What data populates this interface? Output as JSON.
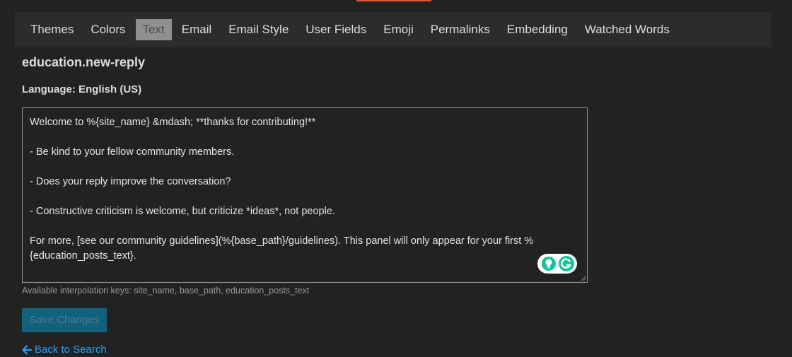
{
  "nav": {
    "items": [
      {
        "label": "Themes"
      },
      {
        "label": "Colors"
      },
      {
        "label": "Text",
        "active": true
      },
      {
        "label": "Email"
      },
      {
        "label": "Email Style"
      },
      {
        "label": "User Fields"
      },
      {
        "label": "Emoji"
      },
      {
        "label": "Permalinks"
      },
      {
        "label": "Embedding"
      },
      {
        "label": "Watched Words"
      }
    ]
  },
  "page": {
    "title": "education.new-reply",
    "language": "Language: English (US)"
  },
  "editor": {
    "value": "Welcome to %{site_name} &mdash; **thanks for contributing!**\n\n- Be kind to your fellow community members.\n\n- Does your reply improve the conversation?\n\n- Constructive criticism is welcome, but criticize *ideas*, not people.\n\nFor more, [see our community guidelines](%{base_path}/guidelines). This panel will only appear for your first %{education_posts_text}.",
    "hint": "Available interpolation keys: site_name, base_path, education_posts_text"
  },
  "actions": {
    "save_label": "Save Changes",
    "back_label": "Back to Search"
  },
  "icons": {
    "grammarly_bulb": "lightbulb-icon",
    "grammarly_logo": "grammarly-icon",
    "back": "arrow-left-icon"
  },
  "colors": {
    "accent": "#e45735",
    "link": "#2c9ff0",
    "primary_button": "#13607c",
    "active_tab": "#909090"
  }
}
